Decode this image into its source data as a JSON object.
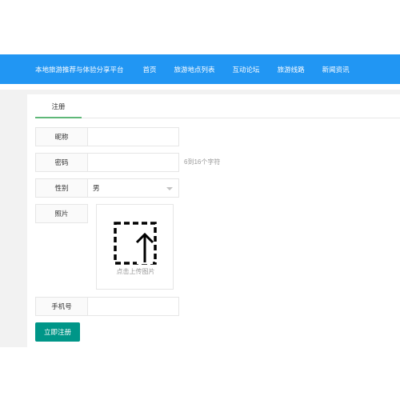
{
  "nav": {
    "brand": "本地旅游推荐与体验分享平台",
    "items": [
      "首页",
      "旅游地点列表",
      "互动论坛",
      "旅游线路",
      "新闻资讯"
    ]
  },
  "tabs": [
    "注册"
  ],
  "form": {
    "nickname_label": "昵称",
    "nickname_value": "",
    "password_label": "密码",
    "password_value": "",
    "password_hint": "6到16个字符",
    "gender_label": "性别",
    "gender_value": "男",
    "photo_label": "照片",
    "upload_text": "点击上传图片",
    "phone_label": "手机号",
    "phone_value": "",
    "submit_label": "立即注册"
  },
  "colors": {
    "nav_bg": "#2196f3",
    "tab_underline": "#5fb878",
    "submit_bg": "#009688"
  }
}
